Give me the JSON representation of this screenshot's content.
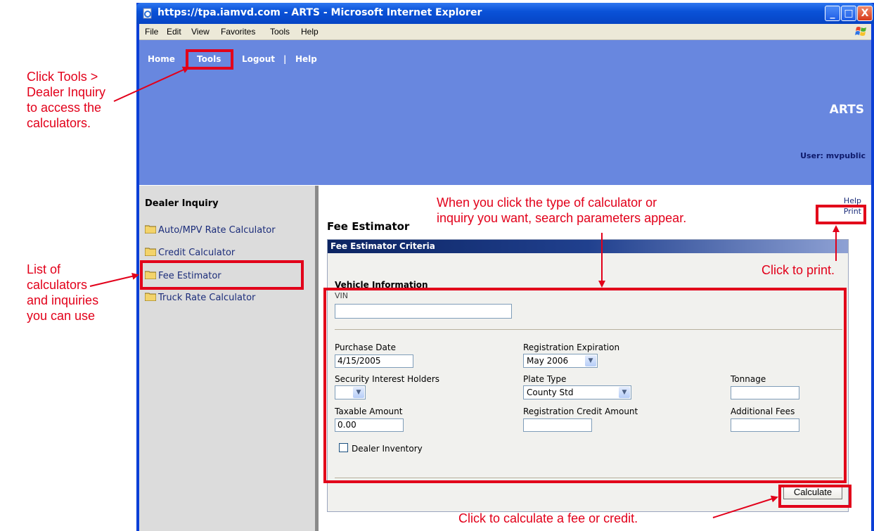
{
  "window": {
    "title": "https://tpa.iamvd.com - ARTS - Microsoft Internet Explorer",
    "minimize_glyph": "_",
    "maximize_glyph": "□",
    "close_glyph": "X"
  },
  "menubar": {
    "items": [
      "File",
      "Edit",
      "View",
      "Favorites",
      "Tools",
      "Help"
    ]
  },
  "nav": {
    "home": "Home",
    "tools": "Tools",
    "logout": "Logout",
    "sep": "|",
    "help": "Help"
  },
  "banner": {
    "title": "ARTS",
    "user": "User: mvpublic"
  },
  "sidebar": {
    "title": "Dealer Inquiry",
    "items": [
      {
        "label": "Auto/MPV Rate Calculator"
      },
      {
        "label": "Credit Calculator"
      },
      {
        "label": "Fee Estimator"
      },
      {
        "label": "Truck Rate Calculator"
      }
    ]
  },
  "main": {
    "help": "Help",
    "print": "Print",
    "title": "Fee Estimator",
    "panel_header": "Fee Estimator Criteria",
    "section": "Vehicle Information",
    "vin_label": "VIN",
    "vin_value": "",
    "purchase_date_label": "Purchase Date",
    "purchase_date_value": "4/15/2005",
    "reg_exp_label": "Registration Expiration",
    "reg_exp_value": "May 2006",
    "sec_holders_label": "Security Interest Holders",
    "sec_holders_value": "",
    "plate_type_label": "Plate Type",
    "plate_type_value": "County Std",
    "tonnage_label": "Tonnage",
    "tonnage_value": "",
    "taxable_label": "Taxable Amount",
    "taxable_value": "0.00",
    "reg_credit_label": "Registration Credit Amount",
    "reg_credit_value": "",
    "additional_fees_label": "Additional Fees",
    "additional_fees_value": "",
    "dealer_inventory_label": "Dealer Inventory",
    "calculate": "Calculate"
  },
  "annotations": {
    "tools_note": [
      "Click Tools >",
      "Dealer Inquiry",
      "to access the",
      "calculators."
    ],
    "list_note": [
      "List of",
      "calculators",
      "and inquiries",
      "you can use"
    ],
    "params_note": [
      "When you click the type of calculator or",
      "inquiry you want, search parameters appear."
    ],
    "print_note": "Click to print.",
    "calc_note": "Click to calculate a fee or credit."
  },
  "colors": {
    "annotation": "#e2001a",
    "banner": "#6887df",
    "xp_blue": "#0b3fd6",
    "sidebar": "#dcdcdc"
  }
}
